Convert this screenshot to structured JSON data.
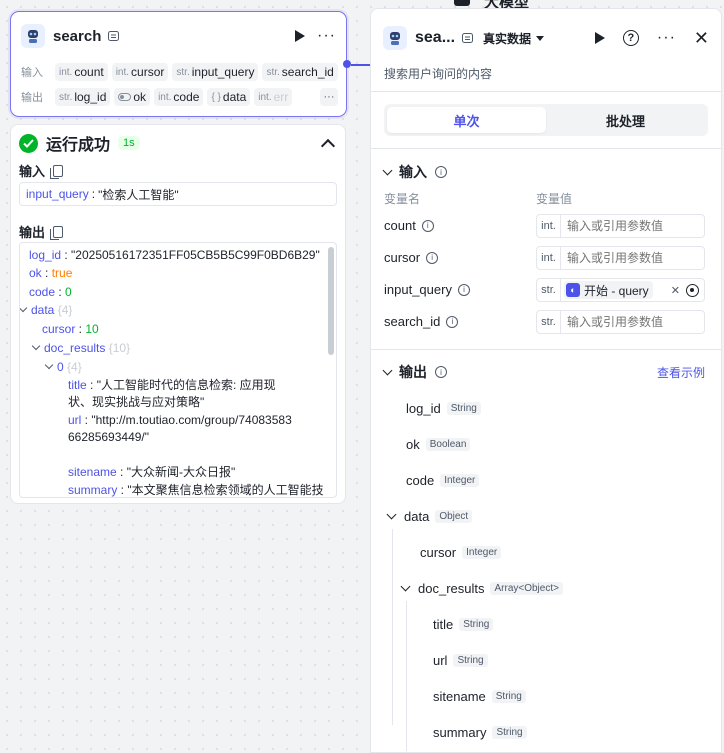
{
  "node": {
    "title": "search",
    "input_label": "输入",
    "output_label": "输出",
    "inputs": [
      {
        "type": "int.",
        "name": "count"
      },
      {
        "type": "int.",
        "name": "cursor"
      },
      {
        "type": "str.",
        "name": "input_query"
      },
      {
        "type": "str.",
        "name": "search_id"
      }
    ],
    "outputs": [
      {
        "type": "str.",
        "name": "log_id"
      },
      {
        "type": "",
        "name": "ok"
      },
      {
        "type": "int.",
        "name": "code"
      },
      {
        "type": "{ }",
        "name": "data"
      },
      {
        "type": "int.",
        "name": "err"
      }
    ],
    "more": "···"
  },
  "result": {
    "title": "运行成功",
    "time": "1s",
    "input_label": "输入",
    "input_key": "input_query",
    "input_value": "\"检索人工智能\"",
    "output_label": "输出",
    "lines": {
      "log_id_key": "log_id",
      "log_id_val": "\"20250516172351FF05CB5B5C99F0BD6B29\"",
      "ok_key": "ok",
      "ok_val": "true",
      "code_key": "code",
      "code_val": "0",
      "data_key": "data",
      "data_count": "{4}",
      "cursor_key": "cursor",
      "cursor_val": "10",
      "doc_key": "doc_results",
      "doc_count": "{10}",
      "item0_key": "0",
      "item0_count": "{4}",
      "title_key": "title",
      "title_val": "\"人工智能时代的信息检索: 应用现状、现实挑战与应对策略\"",
      "url_key": "url",
      "url_val": "\"http://m.toutiao.com/group/7408358366285693449/\"",
      "sitename_key": "sitename",
      "sitename_val": "\"大众新闻-大众日报\"",
      "summary_key": "summary",
      "summary_val": "\"本文聚焦信息检索领域的人工智能技"
    }
  },
  "panel": {
    "title": "sea...",
    "data_source": "真实数据",
    "description": "搜索用户询问的内容",
    "tabs": [
      "单次",
      "批处理"
    ],
    "input_section": "输入",
    "col_name": "变量名",
    "col_value": "变量值",
    "variables": [
      {
        "name": "count",
        "type": "int.",
        "placeholder": "输入或引用参数值"
      },
      {
        "name": "cursor",
        "type": "int.",
        "placeholder": "输入或引用参数值"
      },
      {
        "name": "input_query",
        "type": "str.",
        "ref": "开始 - query"
      },
      {
        "name": "search_id",
        "type": "str.",
        "placeholder": "输入或引用参数值"
      }
    ],
    "output_section": "输出",
    "view_example": "查看示例",
    "outputs": [
      {
        "name": "log_id",
        "type": "String"
      },
      {
        "name": "ok",
        "type": "Boolean"
      },
      {
        "name": "code",
        "type": "Integer"
      },
      {
        "name": "data",
        "type": "Object"
      },
      {
        "name": "cursor",
        "type": "Integer"
      },
      {
        "name": "doc_results",
        "type": "Array<Object>"
      },
      {
        "name": "title",
        "type": "String"
      },
      {
        "name": "url",
        "type": "String"
      },
      {
        "name": "sitename",
        "type": "String"
      },
      {
        "name": "summary",
        "type": "String"
      }
    ]
  },
  "background_node": {
    "title": "大模型"
  },
  "colors": {
    "accent": "#4d53e8",
    "success": "#00b42a",
    "bool": "#ff7d00"
  }
}
